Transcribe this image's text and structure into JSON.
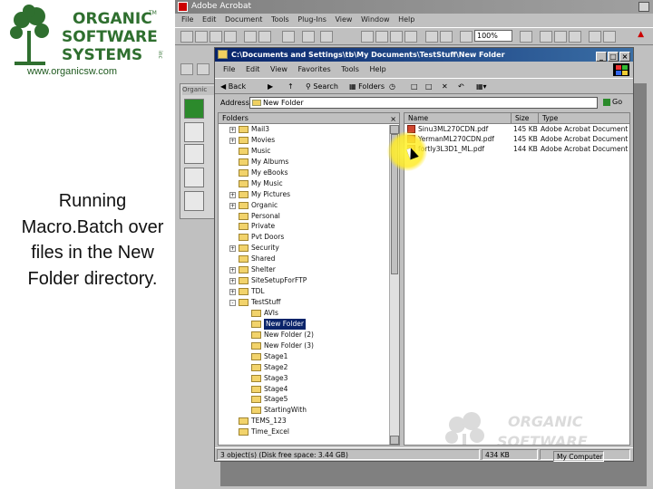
{
  "slide": {
    "logo_lines": [
      "ORGANIC",
      "SOFTWARE",
      "SYSTEMS"
    ],
    "logo_tm": "TM",
    "logo_inc": "inc",
    "url": "www.organicsw.com",
    "caption": "Running Macro.Batch over files in the New Folder directory."
  },
  "acrobat": {
    "title": "Adobe Acrobat",
    "menu": [
      "File",
      "Edit",
      "Document",
      "Tools",
      "Plug-Ins",
      "View",
      "Window",
      "Help"
    ],
    "zoom": "100%",
    "pane_tab": "Organic"
  },
  "explorer": {
    "title": "C:\\Documents and Settings\\tb\\My Documents\\TestStuff\\New Folder",
    "menu": [
      "File",
      "Edit",
      "View",
      "Favorites",
      "Tools",
      "Help"
    ],
    "toolbar": {
      "back": "Back",
      "search": "Search",
      "folders": "Folders"
    },
    "address_label": "Address",
    "address_value": "New Folder",
    "go_label": "Go",
    "folders_header": "Folders",
    "tree": [
      {
        "label": "Mail3",
        "indent": 1,
        "pm": "+"
      },
      {
        "label": "Movies",
        "indent": 1,
        "pm": "+"
      },
      {
        "label": "Music",
        "indent": 1,
        "pm": ""
      },
      {
        "label": "My Albums",
        "indent": 1,
        "pm": ""
      },
      {
        "label": "My eBooks",
        "indent": 1,
        "pm": ""
      },
      {
        "label": "My Music",
        "indent": 1,
        "pm": ""
      },
      {
        "label": "My Pictures",
        "indent": 1,
        "pm": "+"
      },
      {
        "label": "Organic",
        "indent": 1,
        "pm": "+"
      },
      {
        "label": "Personal",
        "indent": 1,
        "pm": ""
      },
      {
        "label": "Private",
        "indent": 1,
        "pm": ""
      },
      {
        "label": "Pvt Doors",
        "indent": 1,
        "pm": ""
      },
      {
        "label": "Security",
        "indent": 1,
        "pm": "+"
      },
      {
        "label": "Shared",
        "indent": 1,
        "pm": ""
      },
      {
        "label": "Shelter",
        "indent": 1,
        "pm": "+"
      },
      {
        "label": "SiteSetupForFTP",
        "indent": 1,
        "pm": "+"
      },
      {
        "label": "TDL",
        "indent": 1,
        "pm": "+"
      },
      {
        "label": "TestStuff",
        "indent": 1,
        "pm": "-"
      },
      {
        "label": "AVIs",
        "indent": 2,
        "pm": ""
      },
      {
        "label": "New Folder",
        "indent": 2,
        "pm": "",
        "selected": true
      },
      {
        "label": "New Folder (2)",
        "indent": 2,
        "pm": ""
      },
      {
        "label": "New Folder (3)",
        "indent": 2,
        "pm": ""
      },
      {
        "label": "Stage1",
        "indent": 2,
        "pm": ""
      },
      {
        "label": "Stage2",
        "indent": 2,
        "pm": ""
      },
      {
        "label": "Stage3",
        "indent": 2,
        "pm": ""
      },
      {
        "label": "Stage4",
        "indent": 2,
        "pm": ""
      },
      {
        "label": "Stage5",
        "indent": 2,
        "pm": ""
      },
      {
        "label": "StartingWith",
        "indent": 2,
        "pm": ""
      },
      {
        "label": "TEMS_123",
        "indent": 1,
        "pm": ""
      },
      {
        "label": "Time_Excel",
        "indent": 1,
        "pm": ""
      }
    ],
    "columns": [
      "Name",
      "Size",
      "Type"
    ],
    "files": [
      {
        "name": "Sinu3ML270CDN.pdf",
        "size": "145 KB",
        "type": "Adobe Acrobat Document"
      },
      {
        "name": "YermanML270CDN.pdf",
        "size": "145 KB",
        "type": "Adobe Acrobat Document"
      },
      {
        "name": "fortly3L3D1_ML.pdf",
        "size": "144 KB",
        "type": "Adobe Acrobat Document"
      }
    ],
    "status": {
      "objects": "3 object(s) (Disk free space: 3.44 GB)",
      "size": "434 KB",
      "location": "My Computer"
    }
  },
  "colors": {
    "titlebar_active": "#0a246a",
    "logo_green": "#2f6f2f",
    "highlight": "#fff03c"
  }
}
